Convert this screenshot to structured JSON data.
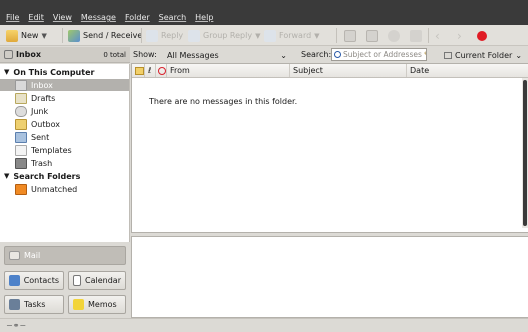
{
  "menu": [
    "File",
    "Edit",
    "View",
    "Message",
    "Folder",
    "Search",
    "Help"
  ],
  "toolbar": {
    "new_label": "New",
    "send_receive_label": "Send / Receive",
    "reply_label": "Reply",
    "reply_group_label": "Group Reply",
    "forward_label": "Forward"
  },
  "folder_header": {
    "title": "Inbox",
    "total": "0 total"
  },
  "tree": {
    "group1": "On This Computer",
    "items": [
      "Inbox",
      "Drafts",
      "Junk",
      "Outbox",
      "Sent",
      "Templates",
      "Trash"
    ],
    "group2": "Search Folders",
    "search_items": [
      "Unmatched"
    ]
  },
  "switcher": {
    "mail": "Mail",
    "contacts": "Contacts",
    "calendar": "Calendar",
    "tasks": "Tasks",
    "memos": "Memos"
  },
  "search": {
    "show_label": "Show:",
    "show_value": "All Messages",
    "search_label": "Search:",
    "placeholder": "Subject or Addresses",
    "scope_value": "Current Folder"
  },
  "columns": {
    "from": "From",
    "subject": "Subject",
    "date": "Date"
  },
  "empty_message": "There are no messages in this folder.",
  "colors": {
    "menubar": "#3a3a3a",
    "selection": "#b3b1ad",
    "delete_red": "#e01b24"
  }
}
